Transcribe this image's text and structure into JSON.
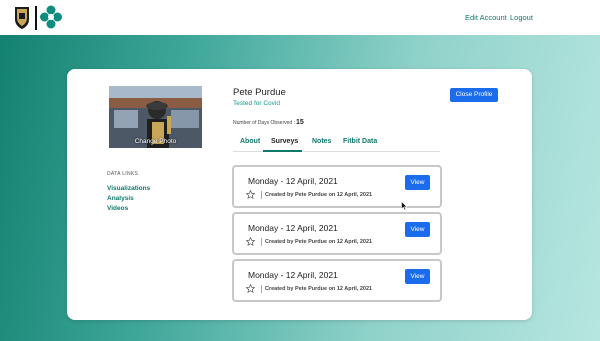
{
  "header": {
    "edit_account": "Edit Account",
    "logout": "Logout",
    "icons": {
      "left_logo": "purdue-logo",
      "right_logo": "merck-logo"
    }
  },
  "profile": {
    "change_photo": "Change Photo",
    "name": "Pete Purdue",
    "status": "Tested for Covid",
    "days_label": "Number of Days Observed :",
    "days_value": "15",
    "close_button": "Close Profile"
  },
  "data_links": {
    "title": "DATA LINKS",
    "items": [
      "Visualizations",
      "Analysis",
      "Videos"
    ]
  },
  "tabs": [
    {
      "label": "About",
      "active": false
    },
    {
      "label": "Surveys",
      "active": true
    },
    {
      "label": "Notes",
      "active": false
    },
    {
      "label": "Fitbit Data",
      "active": false
    }
  ],
  "surveys": [
    {
      "date": "Monday - 12 April, 2021",
      "created": "Created by Pete Purdue on 12 April, 2021",
      "button": "View",
      "starred": false
    },
    {
      "date": "Monday - 12 April, 2021",
      "created": "Created by Pete Purdue on 12 April, 2021",
      "button": "View",
      "starred": false
    },
    {
      "date": "Monday - 12 April, 2021",
      "created": "Created by Pete Purdue on 12 April, 2021",
      "button": "View",
      "starred": false
    }
  ],
  "colors": {
    "accent_teal": "#0f7a6c",
    "button_blue": "#1a6cec",
    "status_teal": "#17998a"
  }
}
